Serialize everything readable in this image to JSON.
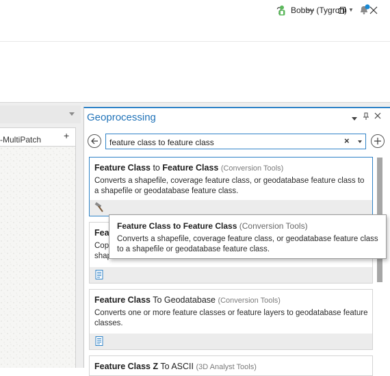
{
  "window": {
    "help_label": "?",
    "user_name": "Bobby (Tygron)"
  },
  "map_view": {
    "tab_label": "-MultiPatch",
    "add_label": "+"
  },
  "geoprocessing": {
    "title": "Geoprocessing",
    "search": {
      "value": "feature class to feature class",
      "clear_label": "×"
    },
    "results": [
      {
        "name_bold_1": "Feature Class",
        "name_mid": " to ",
        "name_bold_2": "Feature Class",
        "toolbox": "(Conversion Tools)",
        "description": "Converts a shapefile, coverage feature class, or geodatabase feature class to a shapefile or geodatabase feature class.",
        "icon": "hammer-icon"
      },
      {
        "name_partial": "Fea",
        "desc_partial_1": "Cop",
        "desc_partial_2": "shap",
        "icon": "script-icon"
      },
      {
        "name_bold_1": "Feature Class",
        "name_mid": " To Geodatabase ",
        "toolbox": "(Conversion Tools)",
        "description": "Converts one or more feature classes or feature layers to geodatabase feature classes.",
        "icon": "script-icon"
      },
      {
        "name_bold_1": "Feature Class",
        "name_bold_2": " Z",
        "name_mid": " To ASCII ",
        "toolbox": "(3D Analyst Tools)"
      }
    ],
    "tooltip": {
      "title": "Feature Class to Feature Class",
      "toolbox": "(Conversion Tools)",
      "description": "Converts a shapefile, coverage feature class, or geodatabase feature class to a shapefile or geodatabase feature class."
    }
  },
  "colors": {
    "accent": "#2e82c7",
    "title_blue": "#1f72b8",
    "notification": "#1a8ad4",
    "user_green": "#5cb85c"
  }
}
